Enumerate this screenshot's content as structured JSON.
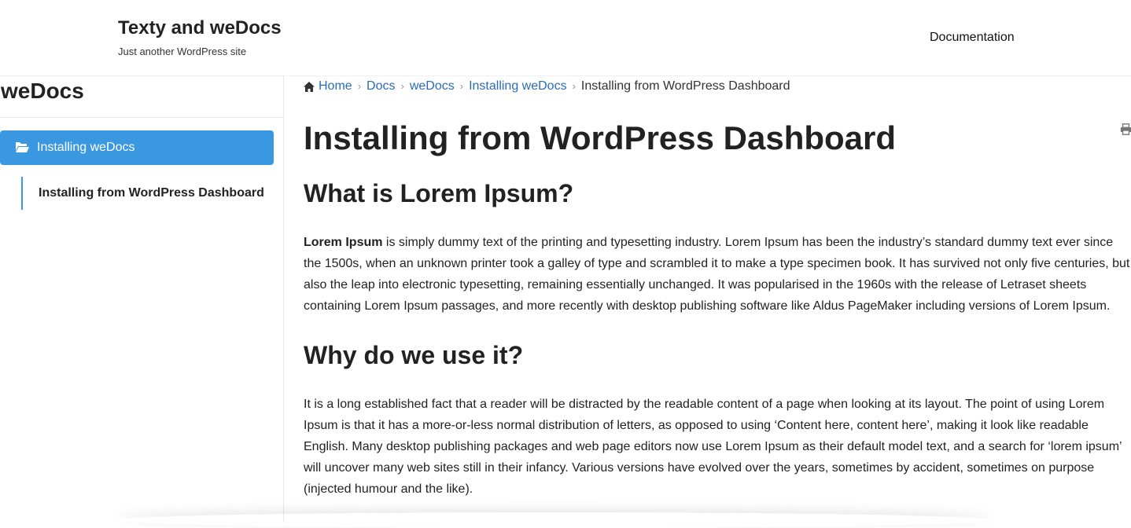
{
  "header": {
    "site_title": "Texty and weDocs",
    "tagline": "Just another WordPress site",
    "nav_item": "Documentation"
  },
  "sidebar": {
    "title": "weDocs",
    "section": {
      "label": "Installing weDocs",
      "icon": "folder-open-icon"
    },
    "children": [
      {
        "label": "Installing from WordPress Dashboard"
      }
    ],
    "accent_color": "#3a98e1"
  },
  "breadcrumb": {
    "home_icon": "home-icon",
    "items": [
      "Home",
      "Docs",
      "weDocs",
      "Installing weDocs"
    ],
    "current": "Installing from WordPress Dashboard",
    "link_color": "#2b6cb8"
  },
  "article": {
    "title": "Installing from WordPress Dashboard",
    "print_icon": "print-icon",
    "sections": [
      {
        "heading": "What is Lorem Ipsum?",
        "bold_lead": "Lorem Ipsum",
        "lines": [
          " is simply dummy text of the printing and typesetting industry. Lorem Ipsum has been the industry’s standard dummy text ever since",
          "the 1500s, when an unknown printer took a galley of type and scrambled it to make a type specimen book. It has survived not only five centuries, but",
          "also the leap into electronic typesetting, remaining essentially unchanged. It was popularised in the 1960s with the release of Letraset sheets",
          "containing Lorem Ipsum passages, and more recently with desktop publishing software like Aldus PageMaker including versions of Lorem Ipsum."
        ]
      },
      {
        "heading": "Why do we use it?",
        "lines": [
          "It is a long established fact that a reader will be distracted by the readable content of a page when looking at its layout. The point of using Lorem",
          "Ipsum is that it has a more-or-less normal distribution of letters, as opposed to using ‘Content here, content here’, making it look like readable",
          "English. Many desktop publishing packages and web page editors now use Lorem Ipsum as their default model text, and a search for ‘lorem ipsum’",
          "will uncover many web sites still in their infancy. Various versions have evolved over the years, sometimes by accident, sometimes on purpose",
          "(injected humour and the like)."
        ]
      }
    ]
  }
}
